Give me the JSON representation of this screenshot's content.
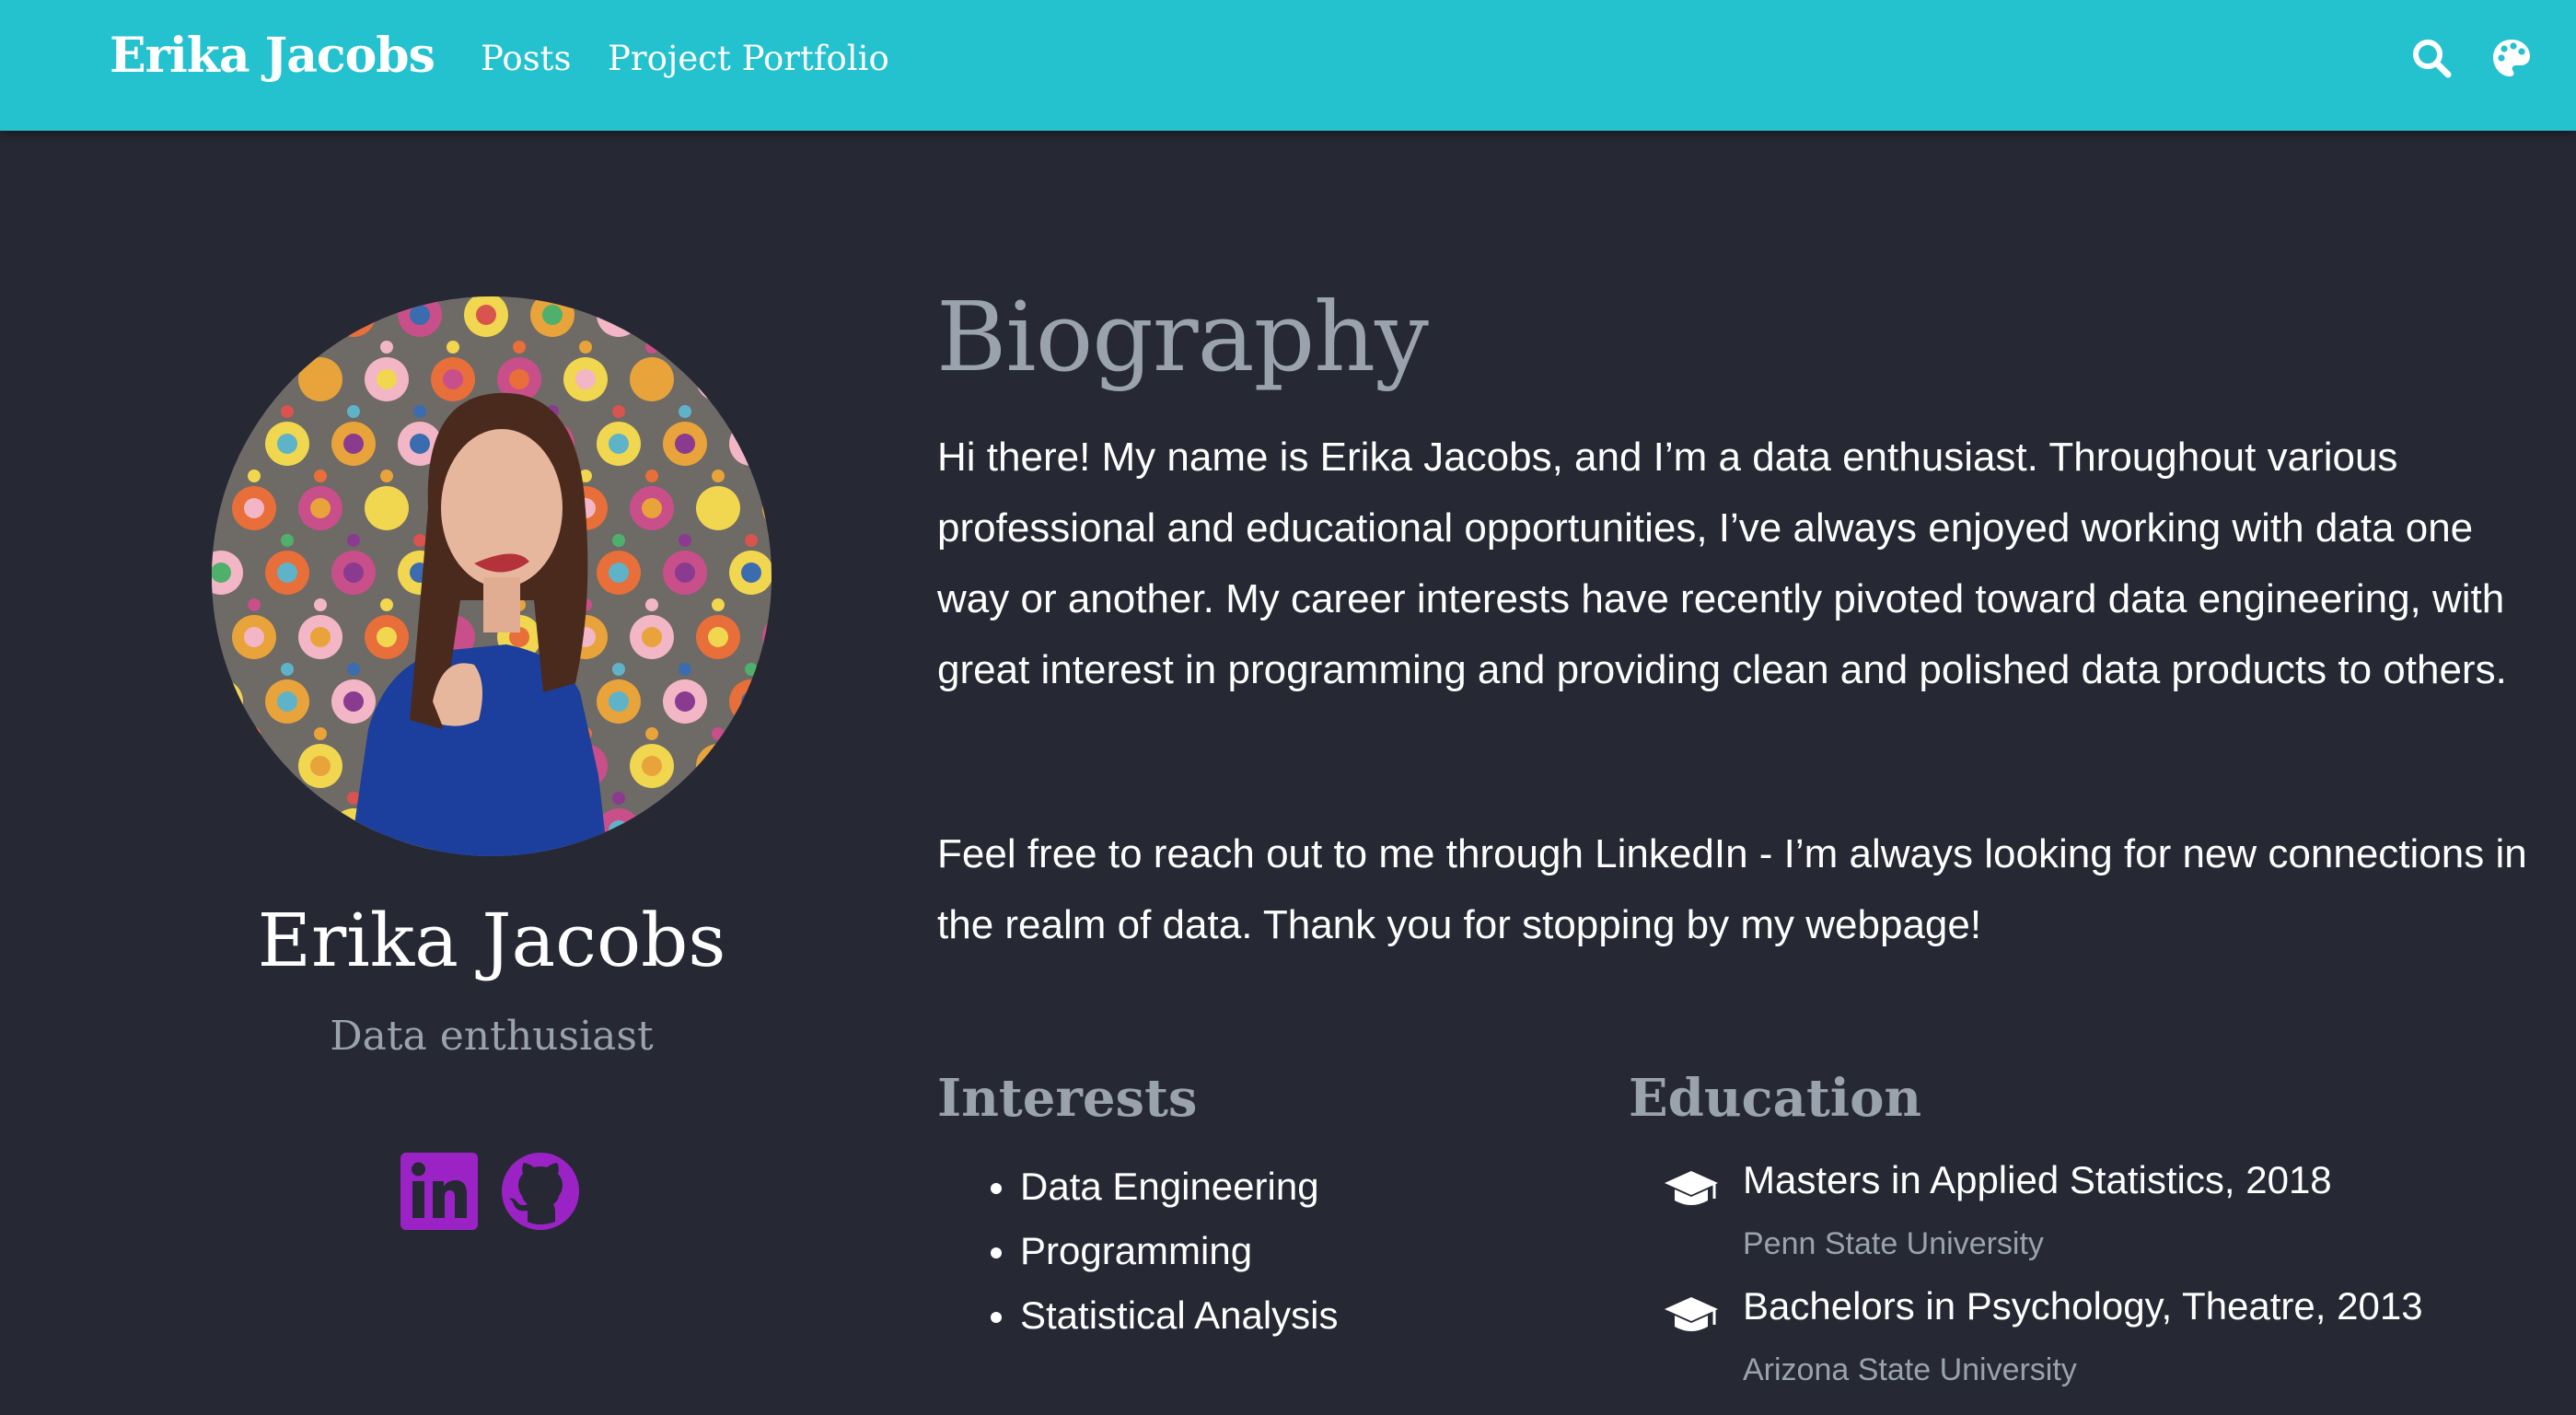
{
  "navbar": {
    "brand": "Erika Jacobs",
    "links": [
      "Posts",
      "Project Portfolio"
    ],
    "icons": [
      "search-icon",
      "palette-icon"
    ],
    "background": "#24c1cf"
  },
  "profile": {
    "name": "Erika Jacobs",
    "role": "Data enthusiast",
    "social": [
      "linkedin-icon",
      "github-icon"
    ],
    "social_color": "#9b23c6"
  },
  "biography": {
    "title": "Biography",
    "paragraphs": [
      "Hi there! My name is Erika Jacobs, and I’m a data enthusiast. Throughout various professional and educational opportunities, I’ve always enjoyed working with data one way or another. My career interests have recently pivoted toward data engineering, with great interest in programming and providing clean and polished data products to others.",
      "Feel free to reach out to me through LinkedIn - I’m always looking for new connections in the realm of data. Thank you for stopping by my webpage!"
    ]
  },
  "interests": {
    "title": "Interests",
    "items": [
      "Data Engineering",
      "Programming",
      "Statistical Analysis"
    ]
  },
  "education": {
    "title": "Education",
    "items": [
      {
        "degree": "Masters in Applied Statistics, 2018",
        "school": "Penn State University"
      },
      {
        "degree": "Bachelors in Psychology, Theatre, 2013",
        "school": "Arizona State University"
      }
    ]
  },
  "colors": {
    "page_background": "#262833",
    "muted_text": "#9aa3ad",
    "text": "#ffffff"
  }
}
